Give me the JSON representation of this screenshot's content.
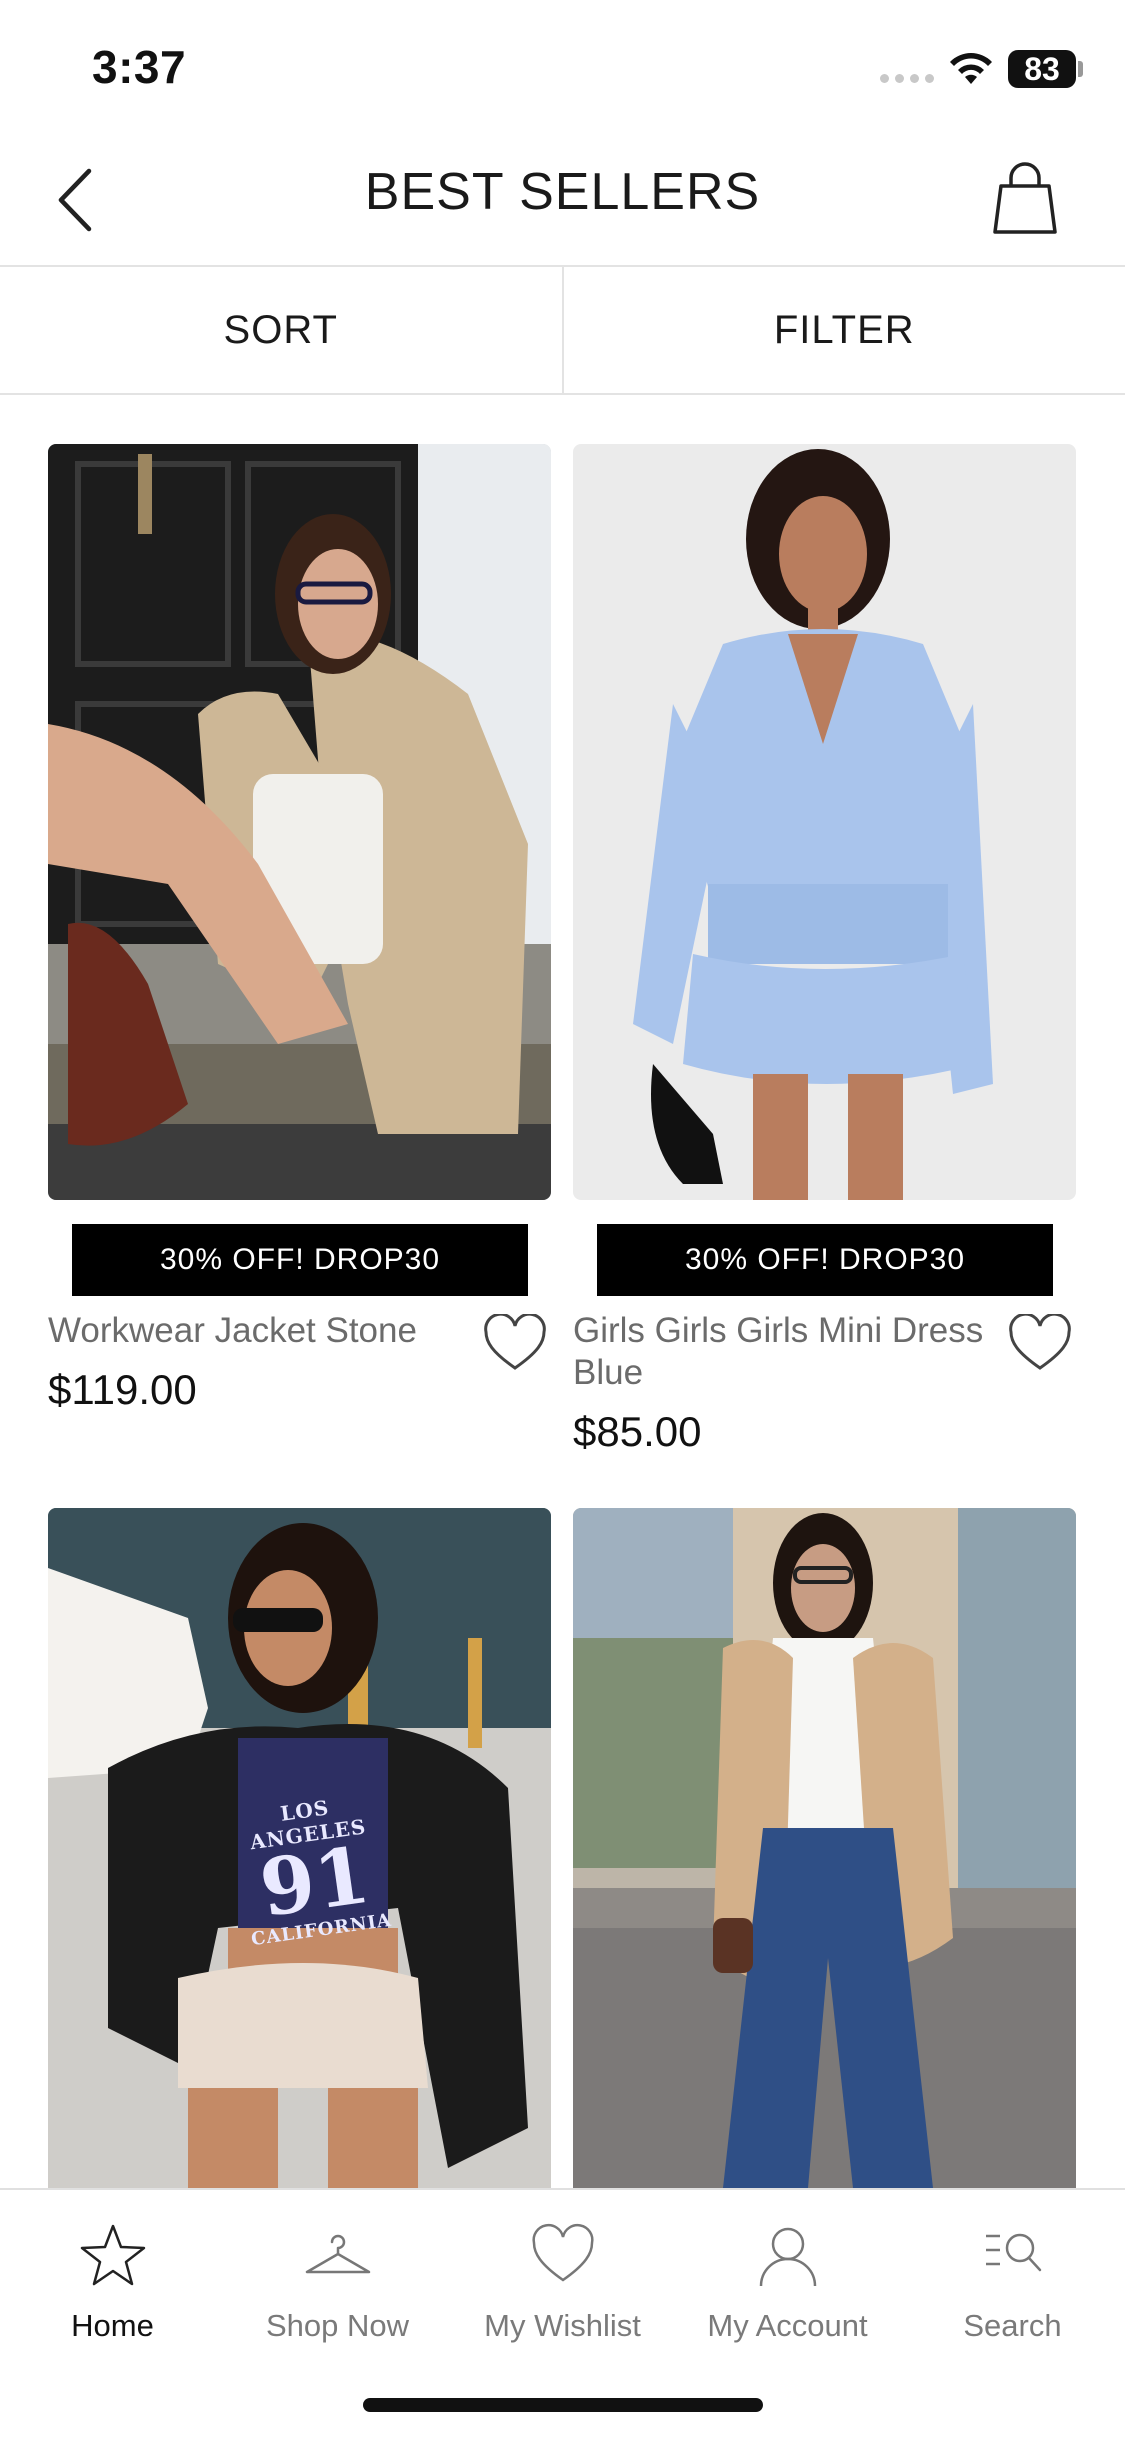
{
  "status_bar": {
    "time": "3:37",
    "battery": "83"
  },
  "header": {
    "title": "BEST SELLERS"
  },
  "sortbar": {
    "sort_label": "SORT",
    "filter_label": "FILTER"
  },
  "products": [
    {
      "name": "Workwear Jacket Stone",
      "price": "$119.00",
      "promo": "30% OFF! DROP30"
    },
    {
      "name": "Girls Girls Girls Mini Dress Blue",
      "price": "$85.00",
      "promo": "30% OFF! DROP30"
    },
    {
      "shirt_text_1": "LOS ANGELES",
      "shirt_text_2": "91",
      "shirt_text_3": "CALIFORNIA"
    }
  ],
  "tabbar": {
    "items": [
      {
        "label": "Home",
        "icon": "star-icon",
        "active": true
      },
      {
        "label": "Shop Now",
        "icon": "hanger-icon"
      },
      {
        "label": "My Wishlist",
        "icon": "heart-icon"
      },
      {
        "label": "My Account",
        "icon": "person-icon"
      },
      {
        "label": "Search",
        "icon": "search-list-icon"
      }
    ]
  }
}
